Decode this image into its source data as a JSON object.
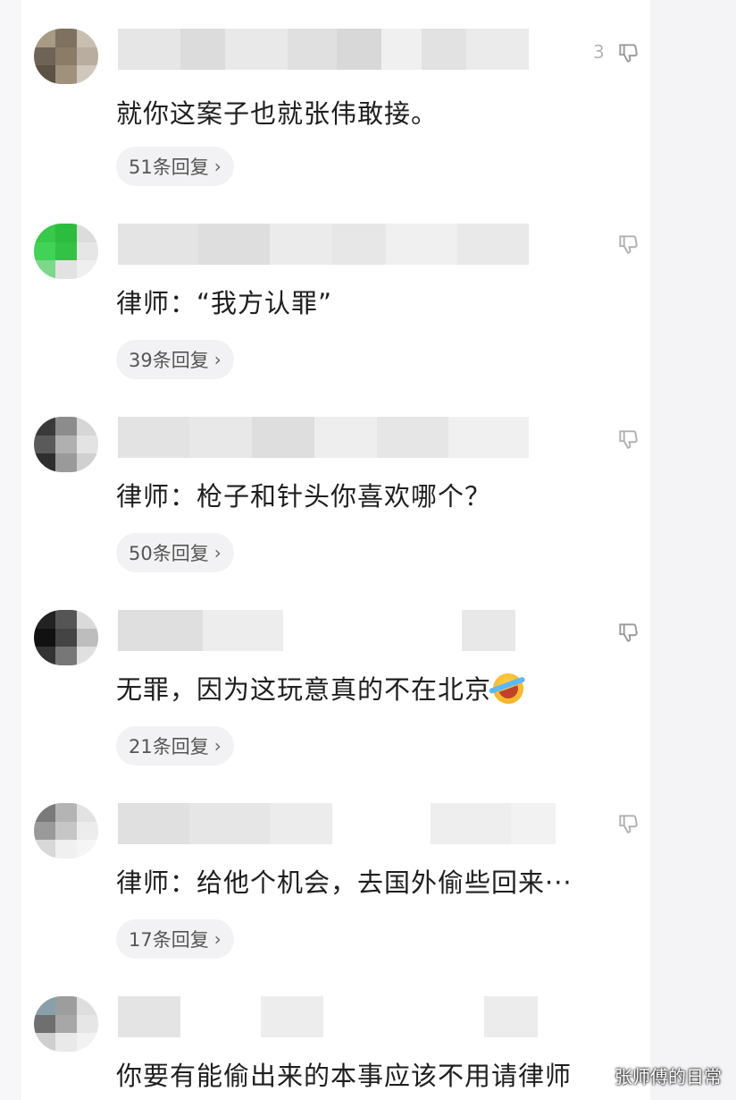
{
  "comments": [
    {
      "text": "就你这案子也就张伟敢接。",
      "replies": "51条回复",
      "dislike_count": "3",
      "avatar_colors": [
        "#a99a86",
        "#7f7160",
        "#c8bfb2",
        "#6d6457",
        "#8b7c68",
        "#b8ad9e",
        "#5c5246",
        "#a0917c",
        "#d0c8bc"
      ]
    },
    {
      "text": "律师：“我方认罪”",
      "replies": "39条回复",
      "dislike_count": "",
      "avatar_colors": [
        "#36c94a",
        "#2cbd3f",
        "#dcdcdc",
        "#40d355",
        "#33c246",
        "#e6e6e6",
        "#7cd88a",
        "#e2e2e2",
        "#efefef"
      ]
    },
    {
      "text": "律师：枪子和针头你喜欢哪个？",
      "replies": "50条回复",
      "dislike_count": "",
      "avatar_colors": [
        "#3a3a3a",
        "#8c8c8c",
        "#d6d6d6",
        "#5a5a5a",
        "#b0b0b0",
        "#e3e3e3",
        "#2e2e2e",
        "#9a9a9a",
        "#d0d0d0"
      ]
    },
    {
      "text": "无罪，因为这玩意真的不在北京",
      "replies": "21条回复",
      "dislike_count": "",
      "avatar_colors": [
        "#222222",
        "#555555",
        "#dadada",
        "#111111",
        "#444444",
        "#bdbdbd",
        "#333333",
        "#777777",
        "#e0e0e0"
      ]
    },
    {
      "text": "律师：给他个机会，去国外偷些回来···",
      "replies": "17条回复",
      "dislike_count": "",
      "avatar_colors": [
        "#7a7a7a",
        "#b4b4b4",
        "#e2e2e2",
        "#9a9a9a",
        "#c6c6c6",
        "#ececec",
        "#d8d8d8",
        "#f0f0f0",
        "#f5f5f5"
      ]
    },
    {
      "text": "你要有能偷出来的本事应该不用请律师",
      "replies": "",
      "dislike_count": "",
      "avatar_colors": [
        "#8aa0a8",
        "#9d9d9d",
        "#dedede",
        "#6f6f6f",
        "#a7a7a7",
        "#e6e6e6",
        "#cfcfcf",
        "#e9e9e9",
        "#f2f2f2"
      ]
    }
  ],
  "watermark": "张师傅的日常",
  "icons": {
    "dislike": "thumbs-down-icon",
    "reply_arrow": "chevron-right-icon"
  }
}
